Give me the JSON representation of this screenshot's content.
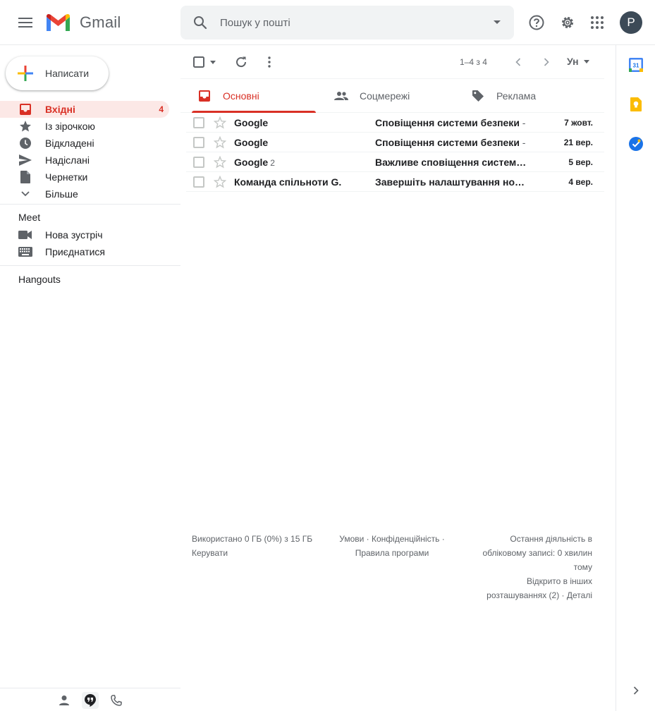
{
  "header": {
    "app_name": "Gmail",
    "search_placeholder": "Пошук у пошті",
    "avatar_letter": "P"
  },
  "sidebar": {
    "compose_label": "Написати",
    "items": [
      {
        "label": "Вхідні",
        "count": "4",
        "icon": "inbox-icon",
        "active": true
      },
      {
        "label": "Із зірочкою",
        "count": "",
        "icon": "star-icon"
      },
      {
        "label": "Відкладені",
        "count": "",
        "icon": "clock-icon"
      },
      {
        "label": "Надіслані",
        "count": "",
        "icon": "send-icon"
      },
      {
        "label": "Чернетки",
        "count": "",
        "icon": "draft-icon"
      },
      {
        "label": "Більше",
        "count": "",
        "icon": "chevron-down-icon"
      }
    ],
    "meet": {
      "title": "Meet",
      "items": [
        {
          "label": "Нова зустріч",
          "icon": "video-icon"
        },
        {
          "label": "Приєднатися",
          "icon": "keyboard-icon"
        }
      ]
    },
    "hangouts_title": "Hangouts"
  },
  "toolbar": {
    "pager": "1–4 з 4",
    "input_tools": "Ун"
  },
  "tabs": [
    {
      "label": "Основні",
      "icon": "inbox-icon",
      "active": true
    },
    {
      "label": "Соцмережі",
      "icon": "people-icon"
    },
    {
      "label": "Реклама",
      "icon": "tag-icon"
    }
  ],
  "emails": [
    {
      "sender": "Google",
      "count": "",
      "subject": "Сповіщення системи безпеки",
      "snippet": " - ",
      "date": "7 жовт."
    },
    {
      "sender": "Google",
      "count": "",
      "subject": "Сповіщення системи безпеки",
      "snippet": " - ",
      "date": "21 вер."
    },
    {
      "sender": "Google",
      "count": "2",
      "subject": "Важливе сповіщення систем…",
      "snippet": "",
      "date": "5 вер."
    },
    {
      "sender": "Команда спільноти G.",
      "count": "",
      "subject": "Завершіть налаштування нов…",
      "snippet": "",
      "date": "4 вер."
    }
  ],
  "footer": {
    "storage": "Використано 0 ГБ (0%) з 15 ГБ",
    "manage": "Керувати",
    "terms": "Умови",
    "privacy": "Конфіденційність",
    "program_policies": "Правила програми",
    "activity_line1": "Остання діяльність в",
    "activity_line2": "обліковому записі: 0 хвилин",
    "activity_line3": "тому",
    "activity_line4": "Відкрито в інших",
    "activity_line5": "розташуваннях (2) ·",
    "details": "Деталі"
  },
  "side_panel": {
    "calendar_day": "31"
  },
  "colors": {
    "accent_red": "#d93025",
    "active_bg": "#fce8e6",
    "search_bg": "#f1f3f4"
  }
}
